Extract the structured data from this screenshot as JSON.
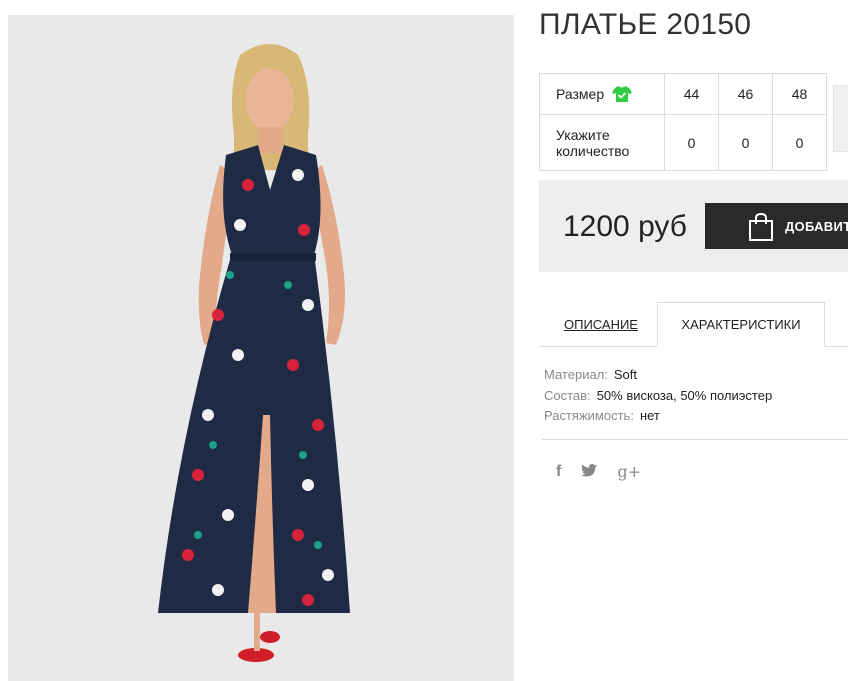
{
  "product": {
    "title": "ПЛАТЬЕ 20150"
  },
  "size_table": {
    "size_label": "Размер",
    "quantity_label": "Укажите количество",
    "sizes": [
      "44",
      "46",
      "48"
    ],
    "quantities": [
      "0",
      "0",
      "0"
    ],
    "size_icon": "tshirt-check-icon",
    "icon_color": "#2ecc40"
  },
  "purchase": {
    "price": "1200 руб",
    "buy_label": "ДОБАВИТЬ"
  },
  "tabs": {
    "description": "ОПИСАНИЕ",
    "characteristics": "ХАРАКТЕРИСТИКИ",
    "active": "characteristics"
  },
  "characteristics": [
    {
      "key": "Материал:",
      "value": "Soft"
    },
    {
      "key": "Состав:",
      "value": "50% вискоза, 50% полиэстер"
    },
    {
      "key": "Растяжимость:",
      "value": "нет"
    }
  ],
  "social": {
    "facebook": "f",
    "twitter": "t",
    "google_plus": "g+"
  },
  "colors": {
    "buy_button": "#2a2a2a",
    "price_box": "#eeeeee",
    "dress": "#1f2a44"
  }
}
